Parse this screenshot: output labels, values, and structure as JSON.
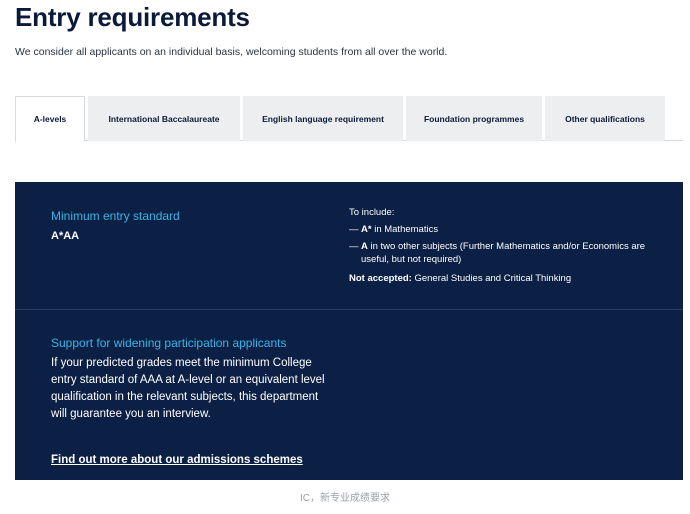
{
  "page": {
    "title": "Entry requirements",
    "intro": "We consider all applicants on an individual basis, welcoming students from all over the world."
  },
  "tabs": [
    {
      "label": "A-levels",
      "active": true
    },
    {
      "label": "International Baccalaureate",
      "active": false
    },
    {
      "label": "English language requirement",
      "active": false
    },
    {
      "label": "Foundation programmes",
      "active": false
    },
    {
      "label": "Other qualifications",
      "active": false
    }
  ],
  "panel": {
    "minimum": {
      "heading": "Minimum entry standard",
      "value": "A*AA"
    },
    "include": {
      "title": "To include:",
      "items": [
        {
          "dash": "—",
          "bold": "A*",
          "text": " in Mathematics"
        },
        {
          "dash": "—",
          "bold": "A",
          "text": " in two other subjects (Further Mathematics and/or Economics are useful, but not required)"
        }
      ],
      "not_accepted_label": "Not accepted:",
      "not_accepted_text": " General Studies and Critical Thinking"
    },
    "widening": {
      "heading": "Support for widening participation applicants",
      "body": "If your predicted grades meet the minimum College entry standard of AAA at A-level or an equivalent level qualification in the relevant subjects, this department will guarantee you an interview.",
      "link": "Find out more about our admissions schemes"
    }
  },
  "caption": "IC，新专业成绩要求",
  "colors": {
    "navy": "#0c1f44",
    "accent_blue": "#36b6e8",
    "tab_bg": "#eceef0"
  }
}
